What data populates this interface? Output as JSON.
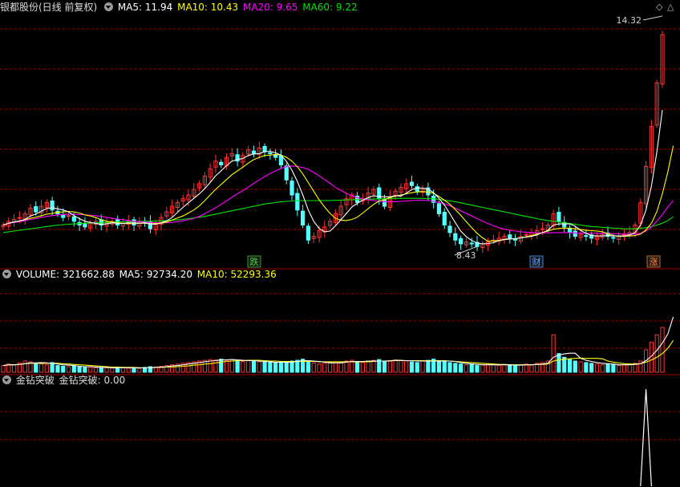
{
  "price_panel": {
    "title": "银都股份(日线 前复权)",
    "ma5": "MA5: 11.94",
    "ma10": "MA10: 10.43",
    "ma20": "MA20: 9.65",
    "ma60": "MA60: 9.22",
    "high_label": "14.32",
    "low_label": "8.43",
    "markers": [
      "跌",
      "财",
      "涨"
    ]
  },
  "volume_panel": {
    "volume": "VOLUME: 321662.88",
    "ma5": "MA5: 92734.20",
    "ma10": "MA10: 52293.36"
  },
  "indicator_panel": {
    "name": "金钻突破",
    "value": "金钻突破: 0.00"
  },
  "colors": {
    "up": "#ff3232",
    "down": "#54ffff",
    "ma5": "#ffffff",
    "ma10": "#ffff00",
    "ma20": "#ff00ff",
    "ma60": "#00e600",
    "grid": "#9b0000"
  },
  "chart_data": {
    "type": "candlestick",
    "price_close": [
      9.0,
      9.1,
      9.15,
      9.2,
      9.3,
      9.45,
      9.35,
      9.5,
      9.6,
      9.4,
      9.3,
      9.2,
      9.25,
      9.1,
      9.0,
      8.95,
      9.05,
      9.1,
      9.0,
      9.05,
      9.1,
      9.0,
      9.05,
      9.1,
      9.0,
      9.1,
      9.05,
      8.9,
      9.05,
      9.2,
      9.35,
      9.5,
      9.6,
      9.7,
      9.8,
      9.95,
      10.1,
      10.3,
      10.5,
      10.7,
      10.6,
      10.8,
      10.9,
      10.7,
      10.85,
      11.0,
      10.9,
      11.05,
      10.95,
      10.9,
      10.8,
      10.6,
      10.2,
      9.8,
      9.4,
      9.0,
      8.6,
      8.7,
      8.85,
      8.95,
      9.1,
      9.3,
      9.5,
      9.7,
      9.8,
      9.6,
      9.7,
      9.85,
      9.95,
      9.7,
      9.5,
      9.75,
      9.9,
      10.0,
      10.1,
      10.05,
      9.9,
      9.95,
      9.8,
      9.6,
      9.3,
      9.0,
      8.8,
      8.6,
      8.5,
      8.55,
      8.5,
      8.43,
      8.5,
      8.55,
      8.6,
      8.65,
      8.7,
      8.65,
      8.6,
      8.7,
      8.75,
      8.8,
      8.85,
      8.9,
      9.0,
      9.3,
      9.1,
      8.95,
      8.8,
      8.7,
      8.75,
      8.7,
      8.65,
      8.7,
      8.75,
      8.7,
      8.65,
      8.7,
      8.75,
      8.8,
      9.0,
      9.6,
      10.56,
      11.62,
      12.78,
      14.06
    ],
    "ma5": [
      9.0,
      9.05,
      9.08,
      9.11,
      9.15,
      9.24,
      9.29,
      9.37,
      9.44,
      9.46,
      9.43,
      9.4,
      9.35,
      9.25,
      9.17,
      9.1,
      9.07,
      9.04,
      9.02,
      9.03,
      9.06,
      9.05,
      9.04,
      9.06,
      9.05,
      9.05,
      9.06,
      9.03,
      9.02,
      9.06,
      9.11,
      9.2,
      9.34,
      9.47,
      9.59,
      9.71,
      9.83,
      9.97,
      10.13,
      10.31,
      10.44,
      10.58,
      10.7,
      10.74,
      10.77,
      10.85,
      10.89,
      10.9,
      10.95,
      10.96,
      10.92,
      10.86,
      10.69,
      10.46,
      10.16,
      9.8,
      9.4,
      9.1,
      8.91,
      8.82,
      8.84,
      8.98,
      9.14,
      9.31,
      9.48,
      9.58,
      9.66,
      9.73,
      9.78,
      9.76,
      9.75,
      9.75,
      9.78,
      9.77,
      9.85,
      9.94,
      9.99,
      9.98,
      9.96,
      9.86,
      9.71,
      9.53,
      9.3,
      9.06,
      8.84,
      8.69,
      8.59,
      8.52,
      8.5,
      8.51,
      8.53,
      8.59,
      8.62,
      8.63,
      8.64,
      8.66,
      8.68,
      8.7,
      8.74,
      8.8,
      8.86,
      9.0,
      9.03,
      9.03,
      9.03,
      8.97,
      8.86,
      8.78,
      8.72,
      8.71,
      8.71,
      8.72,
      8.71,
      8.71,
      8.71,
      8.74,
      8.8,
      9.0,
      9.4,
      10.04,
      10.95,
      12.06
    ],
    "ma10": [
      9.0,
      9.05,
      9.08,
      9.11,
      9.14,
      9.18,
      9.21,
      9.25,
      9.29,
      9.31,
      9.34,
      9.35,
      9.36,
      9.35,
      9.32,
      9.27,
      9.24,
      9.2,
      9.14,
      9.1,
      9.08,
      9.06,
      9.04,
      9.04,
      9.04,
      9.05,
      9.05,
      9.03,
      9.04,
      9.05,
      9.08,
      9.13,
      9.19,
      9.24,
      9.32,
      9.4,
      9.51,
      9.65,
      9.8,
      9.95,
      10.08,
      10.21,
      10.34,
      10.44,
      10.54,
      10.65,
      10.74,
      10.8,
      10.85,
      10.86,
      10.88,
      10.86,
      10.8,
      10.7,
      10.55,
      10.36,
      10.13,
      9.9,
      9.67,
      9.48,
      9.31,
      9.18,
      9.13,
      9.12,
      9.15,
      9.21,
      9.32,
      9.44,
      9.55,
      9.64,
      9.68,
      9.73,
      9.77,
      9.8,
      9.83,
      9.86,
      9.88,
      9.89,
      9.88,
      9.84,
      9.76,
      9.66,
      9.55,
      9.41,
      9.26,
      9.09,
      8.93,
      8.78,
      8.66,
      8.57,
      8.58,
      8.59,
      8.61,
      8.63,
      8.64,
      8.66,
      8.69,
      8.72,
      8.76,
      8.8,
      8.84,
      8.89,
      8.91,
      8.92,
      8.91,
      8.9,
      8.88,
      8.86,
      8.85,
      8.84,
      8.82,
      8.77,
      8.72,
      8.7,
      8.7,
      8.71,
      8.72,
      8.76,
      8.87,
      9.05,
      9.36,
      9.83,
      10.41,
      11.11
    ],
    "ma20": [
      9.0,
      9.04,
      9.07,
      9.09,
      9.12,
      9.15,
      9.17,
      9.2,
      9.23,
      9.25,
      9.27,
      9.28,
      9.29,
      9.29,
      9.28,
      9.27,
      9.26,
      9.25,
      9.23,
      9.2,
      9.18,
      9.16,
      9.14,
      9.12,
      9.1,
      9.09,
      9.08,
      9.07,
      9.06,
      9.06,
      9.06,
      9.07,
      9.09,
      9.11,
      9.14,
      9.18,
      9.23,
      9.3,
      9.38,
      9.46,
      9.55,
      9.64,
      9.74,
      9.83,
      9.92,
      10.01,
      10.11,
      10.2,
      10.29,
      10.37,
      10.44,
      10.51,
      10.55,
      10.57,
      10.56,
      10.53,
      10.48,
      10.4,
      10.31,
      10.21,
      10.11,
      10.0,
      9.92,
      9.84,
      9.78,
      9.73,
      9.69,
      9.67,
      9.65,
      9.63,
      9.62,
      9.62,
      9.62,
      9.63,
      9.64,
      9.65,
      9.66,
      9.66,
      9.65,
      9.63,
      9.6,
      9.56,
      9.51,
      9.45,
      9.38,
      9.31,
      9.24,
      9.17,
      9.1,
      9.04,
      8.98,
      8.93,
      8.89,
      8.86,
      8.84,
      8.82,
      8.81,
      8.8,
      8.79,
      8.79,
      8.79,
      8.8,
      8.8,
      8.8,
      8.8,
      8.79,
      8.78,
      8.78,
      8.78,
      8.78,
      8.78,
      8.78,
      8.77,
      8.77,
      8.76,
      8.76,
      8.76,
      8.78,
      8.84,
      8.95,
      9.1,
      9.28,
      9.48,
      9.65
    ],
    "ma60": [
      8.8,
      8.82,
      8.84,
      8.86,
      8.88,
      8.9,
      8.92,
      8.94,
      8.96,
      8.98,
      9.0,
      9.01,
      9.02,
      9.03,
      9.04,
      9.05,
      9.05,
      9.06,
      9.06,
      9.07,
      9.07,
      9.08,
      9.08,
      9.09,
      9.09,
      9.1,
      9.1,
      9.1,
      9.11,
      9.11,
      9.12,
      9.13,
      9.14,
      9.15,
      9.17,
      9.19,
      9.21,
      9.23,
      9.26,
      9.29,
      9.32,
      9.35,
      9.38,
      9.41,
      9.44,
      9.47,
      9.5,
      9.53,
      9.56,
      9.58,
      9.6,
      9.62,
      9.63,
      9.64,
      9.65,
      9.65,
      9.65,
      9.65,
      9.65,
      9.65,
      9.65,
      9.66,
      9.66,
      9.67,
      9.67,
      9.68,
      9.68,
      9.69,
      9.69,
      9.7,
      9.7,
      9.7,
      9.71,
      9.71,
      9.71,
      9.71,
      9.71,
      9.71,
      9.7,
      9.7,
      9.68,
      9.66,
      9.64,
      9.62,
      9.59,
      9.56,
      9.53,
      9.5,
      9.47,
      9.44,
      9.41,
      9.38,
      9.35,
      9.32,
      9.29,
      9.26,
      9.23,
      9.2,
      9.17,
      9.14,
      9.12,
      9.1,
      9.08,
      9.06,
      9.04,
      9.02,
      9.0,
      8.98,
      8.96,
      8.95,
      8.94,
      8.93,
      8.92,
      8.91,
      8.9,
      8.9,
      8.9,
      8.91,
      8.93,
      8.96,
      9.0,
      9.05,
      9.12,
      9.22
    ],
    "volume": [
      0.18,
      0.22,
      0.2,
      0.25,
      0.3,
      0.28,
      0.24,
      0.22,
      0.2,
      0.26,
      0.18,
      0.16,
      0.15,
      0.17,
      0.14,
      0.13,
      0.14,
      0.12,
      0.13,
      0.12,
      0.11,
      0.12,
      0.13,
      0.11,
      0.12,
      0.1,
      0.13,
      0.15,
      0.14,
      0.16,
      0.18,
      0.2,
      0.22,
      0.24,
      0.26,
      0.28,
      0.3,
      0.32,
      0.34,
      0.33,
      0.35,
      0.32,
      0.34,
      0.3,
      0.29,
      0.31,
      0.3,
      0.28,
      0.27,
      0.26,
      0.25,
      0.27,
      0.29,
      0.3,
      0.32,
      0.35,
      0.3,
      0.25,
      0.22,
      0.24,
      0.26,
      0.28,
      0.27,
      0.3,
      0.32,
      0.28,
      0.26,
      0.3,
      0.32,
      0.34,
      0.3,
      0.31,
      0.33,
      0.32,
      0.3,
      0.28,
      0.26,
      0.3,
      0.32,
      0.35,
      0.3,
      0.28,
      0.26,
      0.24,
      0.22,
      0.2,
      0.22,
      0.18,
      0.2,
      0.22,
      0.2,
      0.18,
      0.2,
      0.19,
      0.18,
      0.2,
      0.22,
      0.2,
      0.24,
      0.26,
      0.3,
      1.0,
      0.5,
      0.4,
      0.35,
      0.3,
      0.28,
      0.26,
      0.24,
      0.22,
      0.2,
      0.22,
      0.2,
      0.18,
      0.2,
      0.22,
      0.24,
      0.3,
      0.6,
      0.8,
      1.0,
      1.2,
      1.5,
      2.3
    ],
    "vol_ma5": [
      0.18,
      0.2,
      0.2,
      0.21,
      0.23,
      0.25,
      0.25,
      0.26,
      0.25,
      0.24,
      0.22,
      0.2,
      0.19,
      0.18,
      0.16,
      0.15,
      0.15,
      0.14,
      0.13,
      0.13,
      0.12,
      0.12,
      0.12,
      0.12,
      0.12,
      0.12,
      0.12,
      0.12,
      0.13,
      0.14,
      0.15,
      0.17,
      0.18,
      0.2,
      0.22,
      0.24,
      0.26,
      0.28,
      0.3,
      0.31,
      0.33,
      0.33,
      0.34,
      0.33,
      0.32,
      0.31,
      0.31,
      0.3,
      0.29,
      0.28,
      0.27,
      0.27,
      0.27,
      0.27,
      0.29,
      0.31,
      0.31,
      0.3,
      0.29,
      0.27,
      0.25,
      0.25,
      0.25,
      0.27,
      0.29,
      0.29,
      0.29,
      0.3,
      0.3,
      0.3,
      0.3,
      0.31,
      0.32,
      0.32,
      0.31,
      0.31,
      0.3,
      0.3,
      0.3,
      0.3,
      0.3,
      0.3,
      0.3,
      0.29,
      0.26,
      0.24,
      0.22,
      0.21,
      0.2,
      0.2,
      0.2,
      0.2,
      0.2,
      0.2,
      0.19,
      0.19,
      0.2,
      0.2,
      0.21,
      0.22,
      0.24,
      0.4,
      0.46,
      0.49,
      0.51,
      0.51,
      0.37,
      0.32,
      0.29,
      0.26,
      0.24,
      0.23,
      0.22,
      0.2,
      0.2,
      0.2,
      0.21,
      0.23,
      0.31,
      0.43,
      0.59,
      0.78,
      1.02,
      1.48
    ],
    "vol_ma10": [
      0.18,
      0.2,
      0.2,
      0.21,
      0.23,
      0.24,
      0.24,
      0.24,
      0.24,
      0.24,
      0.24,
      0.23,
      0.22,
      0.21,
      0.2,
      0.19,
      0.18,
      0.17,
      0.16,
      0.15,
      0.14,
      0.14,
      0.13,
      0.13,
      0.13,
      0.12,
      0.12,
      0.12,
      0.13,
      0.13,
      0.14,
      0.14,
      0.15,
      0.16,
      0.17,
      0.19,
      0.2,
      0.22,
      0.23,
      0.25,
      0.27,
      0.29,
      0.3,
      0.31,
      0.31,
      0.32,
      0.32,
      0.32,
      0.31,
      0.3,
      0.3,
      0.29,
      0.29,
      0.29,
      0.29,
      0.29,
      0.29,
      0.29,
      0.28,
      0.28,
      0.28,
      0.28,
      0.28,
      0.28,
      0.28,
      0.28,
      0.28,
      0.28,
      0.29,
      0.3,
      0.3,
      0.3,
      0.31,
      0.31,
      0.31,
      0.31,
      0.31,
      0.31,
      0.31,
      0.31,
      0.31,
      0.31,
      0.3,
      0.29,
      0.28,
      0.27,
      0.26,
      0.25,
      0.24,
      0.23,
      0.22,
      0.21,
      0.21,
      0.2,
      0.2,
      0.2,
      0.2,
      0.2,
      0.21,
      0.21,
      0.22,
      0.3,
      0.33,
      0.35,
      0.36,
      0.37,
      0.38,
      0.37,
      0.37,
      0.37,
      0.36,
      0.3,
      0.27,
      0.25,
      0.23,
      0.22,
      0.22,
      0.23,
      0.27,
      0.33,
      0.4,
      0.5,
      0.64,
      0.85
    ],
    "indicator": {
      "index_start": 117,
      "values": [
        0,
        1,
        0
      ]
    }
  }
}
